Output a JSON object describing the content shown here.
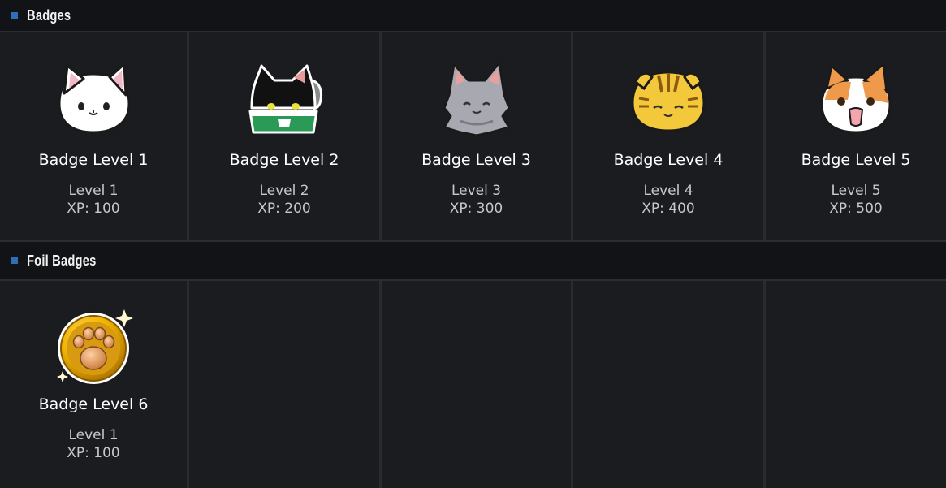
{
  "sections": [
    {
      "title": "Badges",
      "badges": [
        {
          "name": "Badge Level 1",
          "level": "Level 1",
          "xp": "XP: 100",
          "icon": "white-cat-icon"
        },
        {
          "name": "Badge Level 2",
          "level": "Level 2",
          "xp": "XP: 200",
          "icon": "black-cat-bowl-icon"
        },
        {
          "name": "Badge Level 3",
          "level": "Level 3",
          "xp": "XP: 300",
          "icon": "gray-cat-icon"
        },
        {
          "name": "Badge Level 4",
          "level": "Level 4",
          "xp": "XP: 400",
          "icon": "yellow-tabby-cat-icon"
        },
        {
          "name": "Badge Level 5",
          "level": "Level 5",
          "xp": "XP: 500",
          "icon": "orange-cat-icon"
        }
      ]
    },
    {
      "title": "Foil Badges",
      "badges": [
        {
          "name": "Badge Level 6",
          "level": "Level 1",
          "xp": "XP: 100",
          "icon": "gold-paw-coin-icon"
        }
      ]
    }
  ],
  "colors": {
    "background": "#1b1c20",
    "header_background": "#121317",
    "accent": "#2f6fb8",
    "divider": "#2a2b2f",
    "subtext": "#c8c8c8"
  }
}
